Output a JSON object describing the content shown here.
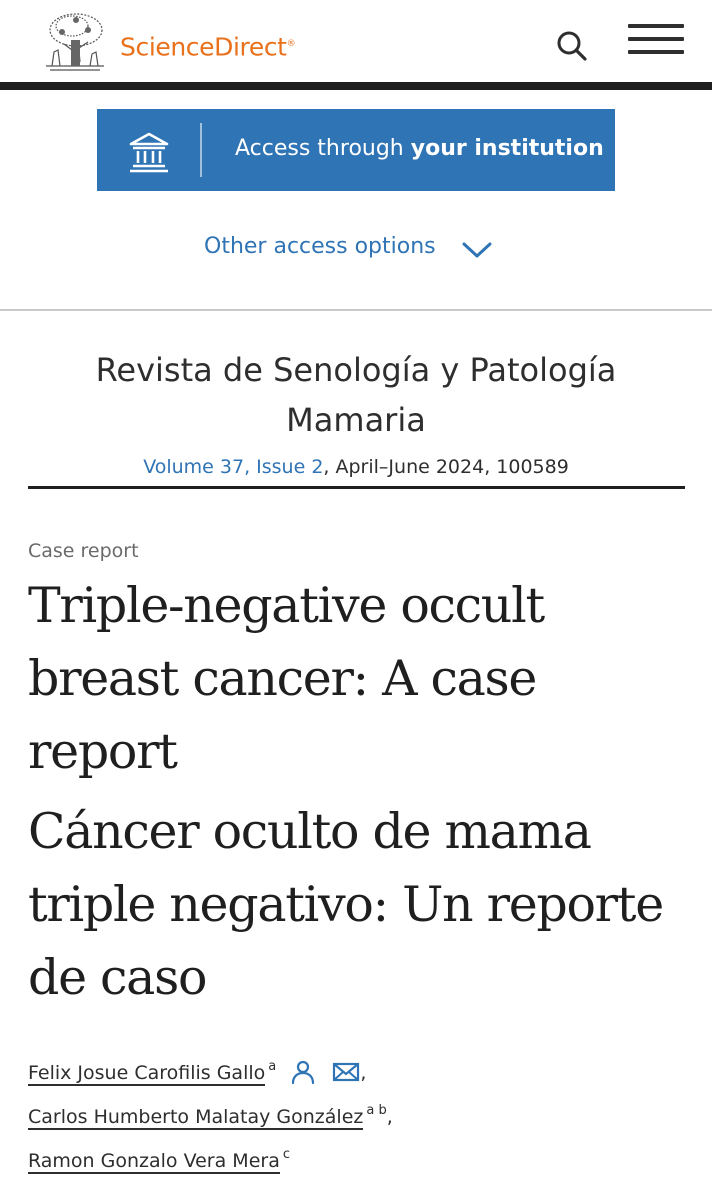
{
  "header": {
    "brand": "ScienceDirect",
    "brand_mark": "®",
    "logo_icon": "elsevier-tree-logo",
    "search_icon": "search-icon",
    "menu_icon": "hamburger-menu-icon"
  },
  "access": {
    "prefix": "Access through ",
    "emphasis": "your institution",
    "icon": "institution-building-icon",
    "other_options": "Other access options"
  },
  "journal": {
    "title": "Revista de Senología y Patología Mamaria",
    "volume_issue": "Volume 37, Issue 2",
    "date_id": ", April–June 2024, 100589"
  },
  "article": {
    "type": "Case report",
    "title_en": "Triple-negative occult breast cancer: A case report",
    "title_es": "Cáncer oculto de mama triple negativo: Un reporte de caso"
  },
  "authors": [
    {
      "name": "Felix Josue Carofilis Gallo",
      "affil": "a",
      "after": ","
    },
    {
      "name": "Carlos Humberto Malatay González",
      "affil": "a b",
      "after": ","
    },
    {
      "name": "Ramon Gonzalo Vera Mera",
      "affil": "c",
      "after": ""
    }
  ],
  "colors": {
    "brand_orange": "#e9711c",
    "link_blue": "#2f74b5",
    "text_dark": "#1f1f1f"
  }
}
